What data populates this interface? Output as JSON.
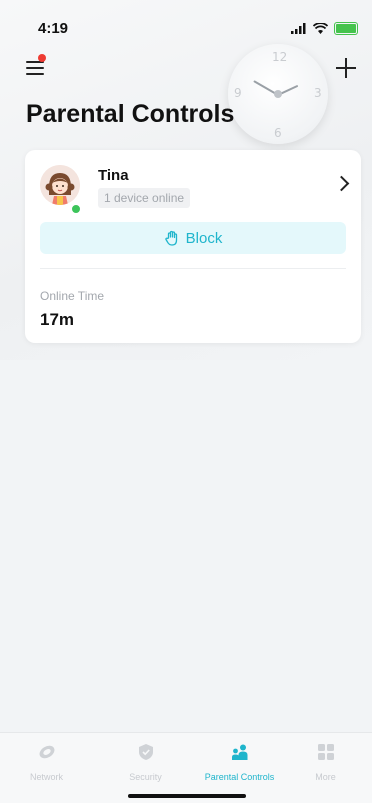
{
  "status_bar": {
    "time": "4:19"
  },
  "header": {
    "title": "Parental Controls"
  },
  "profile": {
    "name": "Tina",
    "device_status": "1 device online",
    "block_label": "Block",
    "online_time_label": "Online Time",
    "online_time_value": "17m"
  },
  "tabs": [
    {
      "label": "Network",
      "icon": "network-icon",
      "active": false
    },
    {
      "label": "Security",
      "icon": "shield-icon",
      "active": false
    },
    {
      "label": "Parental Controls",
      "icon": "people-icon",
      "active": true
    },
    {
      "label": "More",
      "icon": "grid-icon",
      "active": false
    }
  ],
  "colors": {
    "accent": "#1fb5cc",
    "online": "#3cc45a",
    "notification": "#ee3b33"
  }
}
